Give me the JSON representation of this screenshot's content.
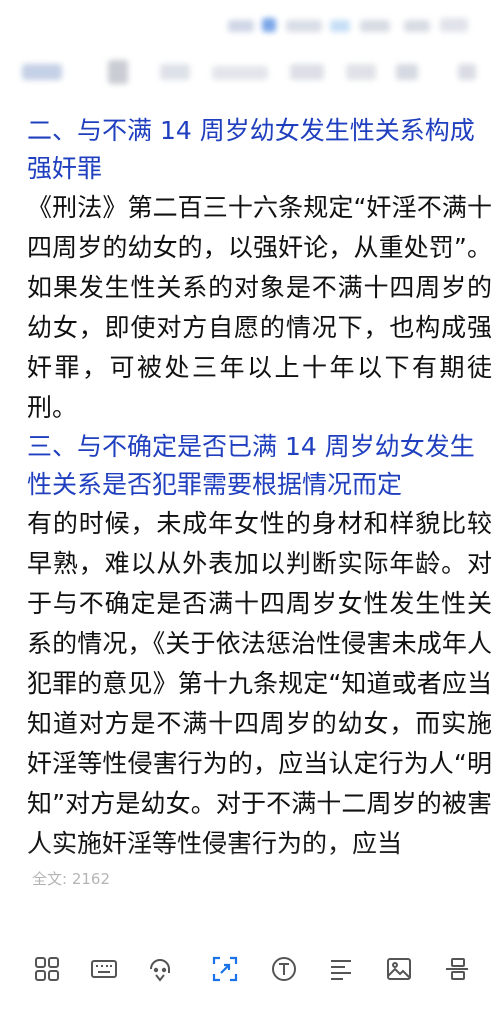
{
  "article": {
    "heading2": "二、与不满 14 周岁幼女发生性关系构成强奸罪",
    "para2": "《刑法》第二百三十六条规定“奸淫不满十四周岁的幼女的，以强奸论，从重处罚”。如果发生性关系的对象是不满十四周岁的幼女，即使对方自愿的情况下，也构成强奸罪，可被处三年以上十年以下有期徒刑。",
    "heading3": "三、与不确定是否已满 14 周岁幼女发生性关系是否犯罪需要根据情况而定",
    "para3": "有的时候，未成年女性的身材和样貌比较早熟，难以从外表加以判断实际年龄。对于与不确定是否满十四周岁女性发生性关系的情况，《关于依法惩治性侵害未成年人犯罪的意见》第十九条规定“知道或者应当知道对方是不满十四周岁的幼女，而实施奸淫等性侵害行为的，应当认定行为人“明知”对方是幼女。对于不满十二周岁的被害人实施奸淫等性侵害行为的，应当"
  },
  "word_count": "全文: 2162",
  "toolbar": {
    "icons": [
      "grid-icon",
      "keyboard-icon",
      "voice-icon",
      "crop-icon",
      "text-icon",
      "align-icon",
      "image-icon",
      "more-icon"
    ],
    "active": "crop-icon",
    "accent": "#1a73e8",
    "icon_color": "#555555"
  },
  "colors": {
    "heading": "#1f3fbf",
    "body": "#111111"
  }
}
